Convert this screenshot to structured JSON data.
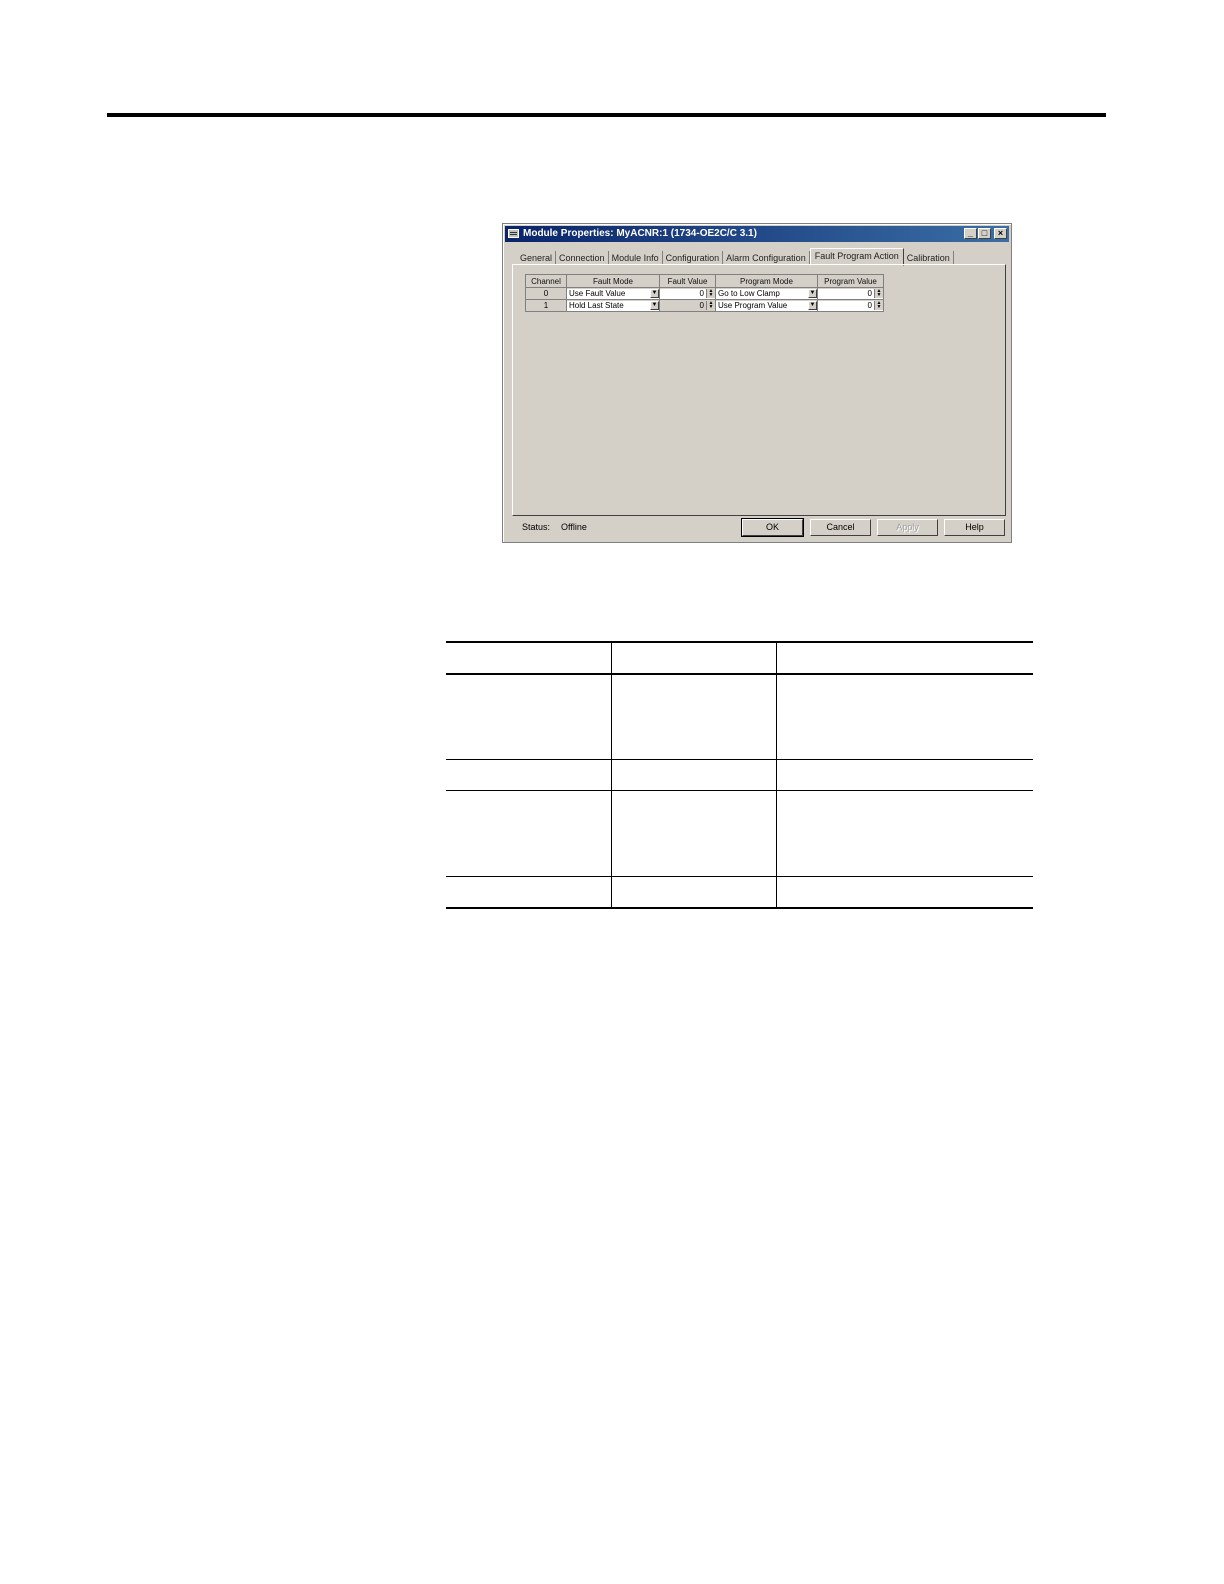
{
  "dialog": {
    "title": "Module Properties: MyACNR:1 (1734-OE2C/C 3.1)",
    "window_buttons": [
      "_",
      "□",
      "×"
    ],
    "tabs": [
      {
        "label": "General",
        "active": false
      },
      {
        "label": "Connection",
        "active": false
      },
      {
        "label": "Module Info",
        "active": false
      },
      {
        "label": "Configuration",
        "active": false
      },
      {
        "label": "Alarm Configuration",
        "active": false
      },
      {
        "label": "Fault Program Action",
        "active": true
      },
      {
        "label": "Calibration",
        "active": false
      }
    ],
    "grid": {
      "headers": [
        "Channel",
        "Fault Mode",
        "Fault Value",
        "Program Mode",
        "Program Value"
      ],
      "rows": [
        {
          "channel": "0",
          "fault_mode": "Use Fault Value",
          "fault_value": "0",
          "fault_value_enabled": true,
          "program_mode": "Go to Low Clamp",
          "program_value": "0"
        },
        {
          "channel": "1",
          "fault_mode": "Hold Last State",
          "fault_value": "0",
          "fault_value_enabled": false,
          "program_mode": "Use Program Value",
          "program_value": "0"
        }
      ]
    },
    "status_label": "Status:",
    "status_value": "Offline",
    "buttons": {
      "ok": "OK",
      "cancel": "Cancel",
      "apply": "Apply",
      "help": "Help"
    }
  },
  "colors": {
    "title_bar": "#0a246a",
    "dialog_face": "#d4d0c8"
  }
}
